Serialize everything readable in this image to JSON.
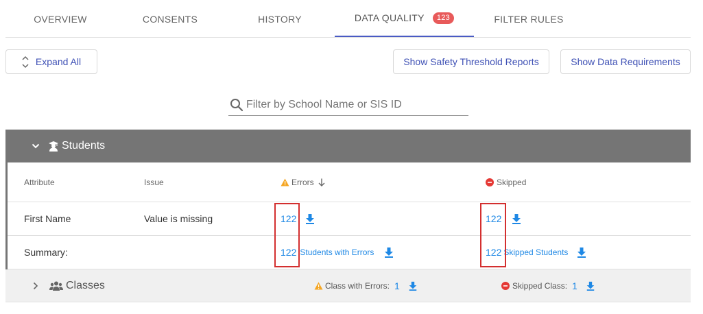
{
  "tabs": [
    {
      "label": "OVERVIEW"
    },
    {
      "label": "CONSENTS"
    },
    {
      "label": "HISTORY"
    },
    {
      "label": "DATA QUALITY",
      "badge": "123",
      "active": true
    },
    {
      "label": "FILTER RULES"
    }
  ],
  "toolbar": {
    "expand_all": "Expand All",
    "safety_reports": "Show Safety Threshold Reports",
    "data_requirements": "Show Data Requirements"
  },
  "search": {
    "placeholder": "Filter by School Name or SIS ID",
    "value": ""
  },
  "students": {
    "title": "Students",
    "columns": {
      "attribute": "Attribute",
      "issue": "Issue",
      "errors": "Errors",
      "skipped": "Skipped"
    },
    "rows": [
      {
        "attribute": "First Name",
        "issue": "Value is missing",
        "errors": "122",
        "skipped": "122"
      }
    ],
    "summary": {
      "label": "Summary:",
      "errors": "122",
      "errors_link": "Students with Errors",
      "skipped": "122",
      "skipped_link": "Skipped Students"
    }
  },
  "classes": {
    "title": "Classes",
    "errors_label": "Class with Errors:",
    "errors_count": "1",
    "skipped_label": "Skipped Class:",
    "skipped_count": "1"
  },
  "colors": {
    "accent": "#3f51b5",
    "link": "#1e88e5",
    "badge": "#e85a5a",
    "warning": "#f5a623",
    "error": "#e53935",
    "section_header": "#757575",
    "highlight": "#d32f2f"
  }
}
